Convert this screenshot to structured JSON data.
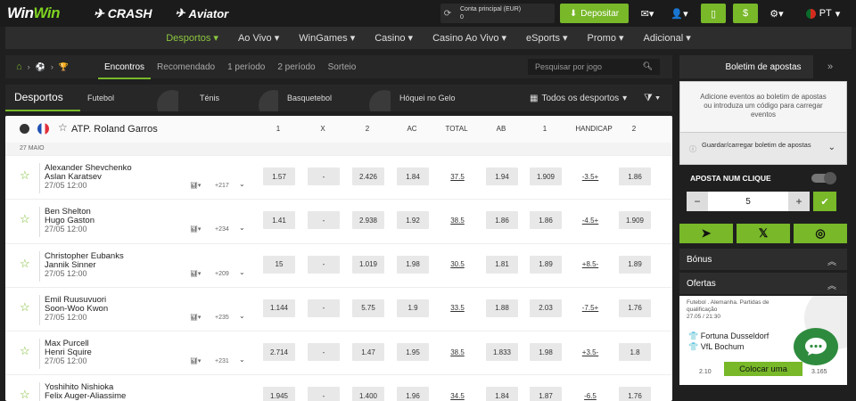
{
  "topbar": {
    "logo_a": "Win",
    "logo_b": "Win",
    "crash": "CRASH",
    "aviator": "Aviator",
    "account_label": "Conta principal (EUR)",
    "account_value": "0",
    "deposit": "Depositar",
    "lang": "PT"
  },
  "nav": [
    "Desportos",
    "Ao Vivo",
    "WinGames",
    "Casino",
    "Casino Ao Vivo",
    "eSports",
    "Promo",
    "Adicional"
  ],
  "filters": {
    "tabs": [
      "Encontros",
      "Recomendado",
      "1 período",
      "2 período",
      "Sorteio"
    ],
    "search_placeholder": "Pesquisar por jogo"
  },
  "sports": {
    "title": "Desportos",
    "items": [
      "Futebol",
      "Ténis",
      "Basquetebol",
      "Hóquei no Gelo"
    ],
    "all": "Todos os desportos"
  },
  "league": {
    "title": "ATP. Roland Garros",
    "columns": [
      "1",
      "X",
      "2",
      "AC",
      "TOTAL",
      "AB",
      "1",
      "HANDICAP",
      "2"
    ],
    "date": "27 MAIO"
  },
  "matches": [
    {
      "p1": "Alexander Shevchenko",
      "p2": "Aslan Karatsev",
      "time": "27/05 12:00",
      "more": "+217",
      "odds": [
        "1.57",
        "-",
        "2.426",
        "1.84",
        "37.5",
        "1.94",
        "1.909",
        "-3.5+",
        "1.86"
      ]
    },
    {
      "p1": "Ben Shelton",
      "p2": "Hugo Gaston",
      "time": "27/05 12:00",
      "more": "+234",
      "odds": [
        "1.41",
        "-",
        "2.938",
        "1.92",
        "38.5",
        "1.86",
        "1.86",
        "-4.5+",
        "1.909"
      ]
    },
    {
      "p1": "Christopher Eubanks",
      "p2": "Jannik Sinner",
      "time": "27/05 12:00",
      "more": "+209",
      "odds": [
        "15",
        "-",
        "1.019",
        "1.98",
        "30.5",
        "1.81",
        "1.89",
        "+8.5-",
        "1.89"
      ]
    },
    {
      "p1": "Emil Ruusuvuori",
      "p2": "Soon-Woo Kwon",
      "time": "27/05 12:00",
      "more": "+235",
      "odds": [
        "1.144",
        "-",
        "5.75",
        "1.9",
        "33.5",
        "1.88",
        "2.03",
        "-7.5+",
        "1.76"
      ]
    },
    {
      "p1": "Max Purcell",
      "p2": "Henri Squire",
      "time": "27/05 12:00",
      "more": "+231",
      "odds": [
        "2.714",
        "-",
        "1.47",
        "1.95",
        "38.5",
        "1.833",
        "1.98",
        "+3.5-",
        "1.8"
      ]
    },
    {
      "p1": "Yoshihito Nishioka",
      "p2": "Felix Auger-Aliassime",
      "time": "27/05 12:00",
      "more": "+220",
      "odds": [
        "1.945",
        "-",
        "1.400",
        "1.96",
        "34.5",
        "1.84",
        "1.87",
        "-6.5",
        "1.76"
      ]
    }
  ],
  "betslip": {
    "title": "Boletim de apostas",
    "info": "Adicione eventos ao boletim de apostas ou introduza um código para carregar eventos",
    "load": "Guardar/carregar boletim de apostas",
    "oneclick": "APOSTA NUM CLIQUE",
    "stake": "5",
    "bonus": "Bónus",
    "offers": "Ofertas"
  },
  "offer": {
    "league": "Futebol . Alemanha. Partidas de qualificação",
    "date": "27.05 / 21:30",
    "team1": "Fortuna Dusseldorf",
    "team2": "VfL Bochum",
    "button": "Colocar uma",
    "v1": "2.10",
    "v2": "3.165"
  }
}
